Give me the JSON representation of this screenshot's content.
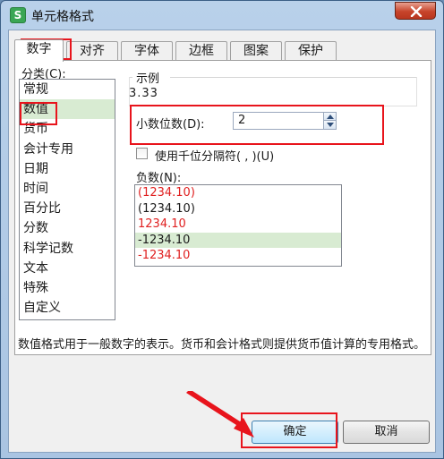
{
  "window": {
    "title": "单元格格式",
    "app_icon_letter": "S"
  },
  "tabs": [
    {
      "label": "数字",
      "active": true
    },
    {
      "label": "对齐",
      "active": false
    },
    {
      "label": "字体",
      "active": false
    },
    {
      "label": "边框",
      "active": false
    },
    {
      "label": "图案",
      "active": false
    },
    {
      "label": "保护",
      "active": false
    }
  ],
  "category": {
    "label": "分类(C):",
    "items": [
      "常规",
      "数值",
      "货币",
      "会计专用",
      "日期",
      "时间",
      "百分比",
      "分数",
      "科学记数",
      "文本",
      "特殊",
      "自定义"
    ],
    "selected": "数值"
  },
  "sample": {
    "label": "示例",
    "value": "3.33"
  },
  "decimal_places": {
    "label": "小数位数(D):",
    "value": "2"
  },
  "thousands_separator": {
    "label": "使用千位分隔符( , )(U)",
    "checked": false
  },
  "negative": {
    "label": "负数(N):",
    "items": [
      {
        "text": "(1234.10)",
        "color": "#e02020"
      },
      {
        "text": "(1234.10)",
        "color": "#1a1a1a"
      },
      {
        "text": "1234.10",
        "color": "#e02020"
      },
      {
        "text": "-1234.10",
        "color": "#1a1a1a"
      },
      {
        "text": "-1234.10",
        "color": "#e02020"
      }
    ],
    "selected_index": 3
  },
  "description": "数值格式用于一般数字的表示。货币和会计格式则提供货币值计算的专用格式。",
  "buttons": {
    "ok": "确定",
    "cancel": "取消"
  },
  "colors": {
    "highlight": "#e8141c",
    "selection": "#d8ebd2",
    "title_bar": "#b9d1ea"
  }
}
